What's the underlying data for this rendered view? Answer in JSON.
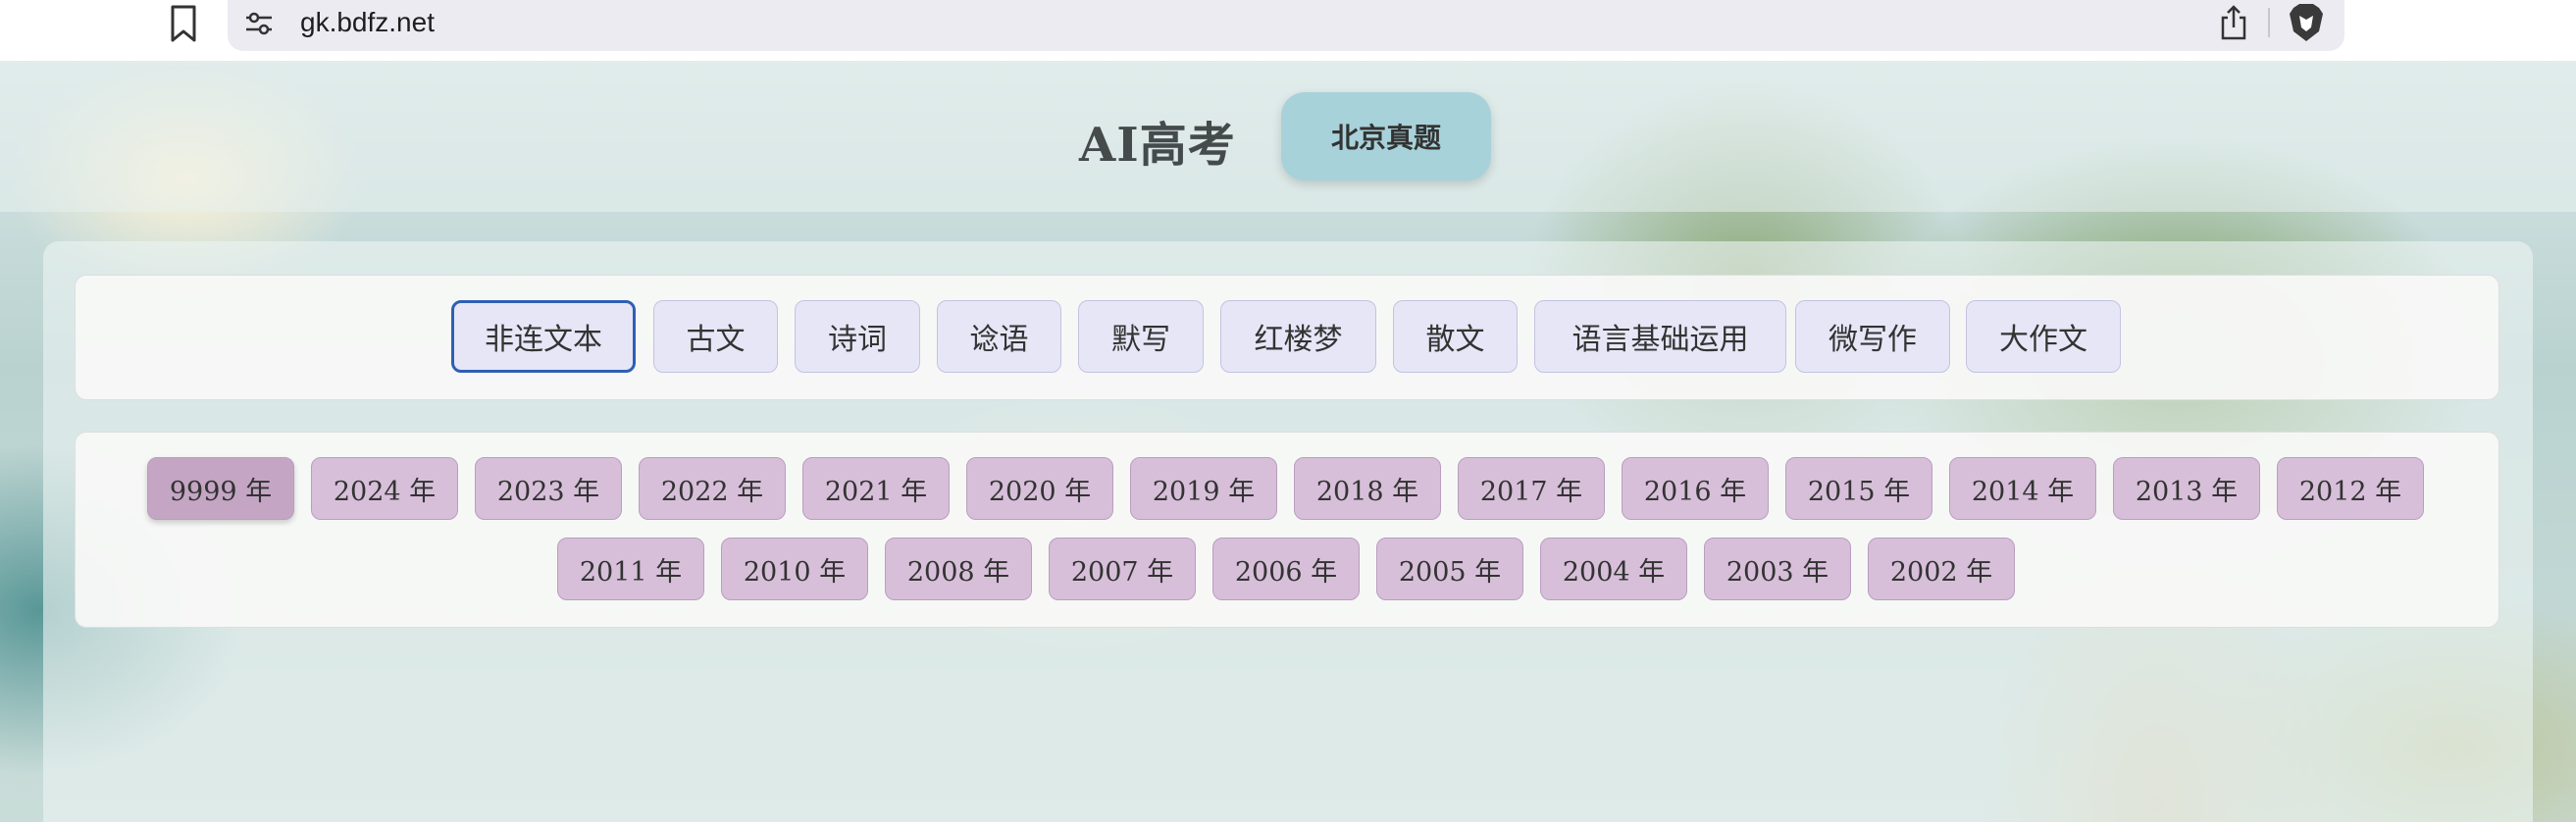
{
  "browser": {
    "url": "gk.bdfz.net",
    "icons": [
      "bookmark-icon",
      "site-settings-icon",
      "share-icon",
      "brave-lion-icon"
    ]
  },
  "header": {
    "title": "AI高考",
    "region_button": "北京真题"
  },
  "categories": [
    {
      "label": "非连文本",
      "active": true
    },
    {
      "label": "古文"
    },
    {
      "label": "诗词"
    },
    {
      "label": "谂语"
    },
    {
      "label": "默写"
    },
    {
      "label": "红楼梦"
    },
    {
      "label": "散文"
    },
    {
      "label": "语言基础运用"
    },
    {
      "label": "微写作"
    },
    {
      "label": "大作文"
    }
  ],
  "years": [
    {
      "label": "9999 年",
      "active": true
    },
    {
      "label": "2024 年"
    },
    {
      "label": "2023 年"
    },
    {
      "label": "2022 年"
    },
    {
      "label": "2021 年"
    },
    {
      "label": "2020 年"
    },
    {
      "label": "2019 年"
    },
    {
      "label": "2018 年"
    },
    {
      "label": "2017 年"
    },
    {
      "label": "2016 年"
    },
    {
      "label": "2015 年"
    },
    {
      "label": "2014 年"
    },
    {
      "label": "2013 年"
    },
    {
      "label": "2012 年"
    },
    {
      "label": "2011 年"
    },
    {
      "label": "2010 年"
    },
    {
      "label": "2008 年"
    },
    {
      "label": "2007 年"
    },
    {
      "label": "2006 年"
    },
    {
      "label": "2005 年"
    },
    {
      "label": "2004 年"
    },
    {
      "label": "2003 年"
    },
    {
      "label": "2002 年"
    }
  ],
  "colors": {
    "category_bg": "#e6e6f7",
    "category_active_border": "#2f5fb3",
    "year_bg": "#d7bfd9",
    "year_active_bg": "#c4a6c4",
    "region_button_bg": "#a8d2da"
  }
}
